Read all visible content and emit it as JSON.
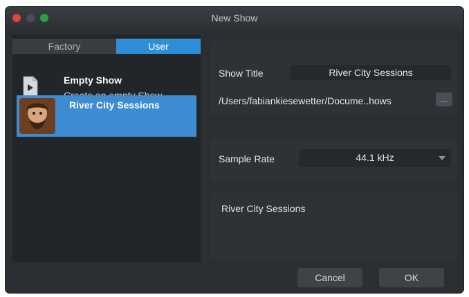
{
  "window": {
    "title": "New Show"
  },
  "left": {
    "tabs": [
      {
        "label": "Factory"
      },
      {
        "label": "User"
      }
    ],
    "templates": [
      {
        "title": "Empty Show",
        "description": "Create an empty Show",
        "icon": "document-play-icon"
      }
    ],
    "selected": {
      "title": "River City Sessions",
      "icon": "user-avatar"
    }
  },
  "right": {
    "show_title_label": "Show Title",
    "show_title_value": "River City Sessions",
    "path_value": "/Users/fabiankiesewetter/Docume..hows",
    "browse_label": "...",
    "sample_rate_label": "Sample Rate",
    "sample_rate_value": "44.1 kHz",
    "notes_value": "River City Sessions"
  },
  "footer": {
    "cancel_label": "Cancel",
    "ok_label": "OK"
  },
  "colors": {
    "accent": "#2f8fd6",
    "close": "#e0443e",
    "zoom": "#2ea043"
  }
}
